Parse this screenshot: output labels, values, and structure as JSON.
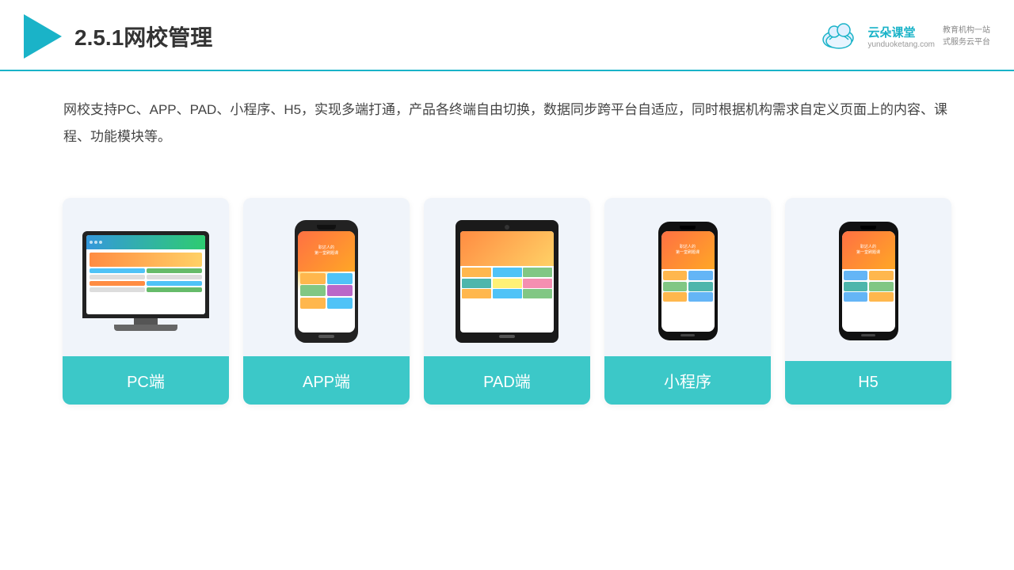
{
  "header": {
    "title": "2.5.1网校管理",
    "brand": {
      "name": "云朵课堂",
      "domain": "yunduoketang.com",
      "tagline": "教育机构一站\n式服务云平台"
    }
  },
  "description": "网校支持PC、APP、PAD、小程序、H5，实现多端打通，产品各终端自由切换，数据同步跨平台自适应，同时根据机构需求自定义页面上的内容、课程、功能模块等。",
  "cards": [
    {
      "id": "pc",
      "label": "PC端"
    },
    {
      "id": "app",
      "label": "APP端"
    },
    {
      "id": "pad",
      "label": "PAD端"
    },
    {
      "id": "miniapp",
      "label": "小程序"
    },
    {
      "id": "h5",
      "label": "H5"
    }
  ],
  "colors": {
    "accent": "#1ab3c8",
    "card_bg": "#eef2f8",
    "card_label_bg": "#3cc8c8"
  }
}
